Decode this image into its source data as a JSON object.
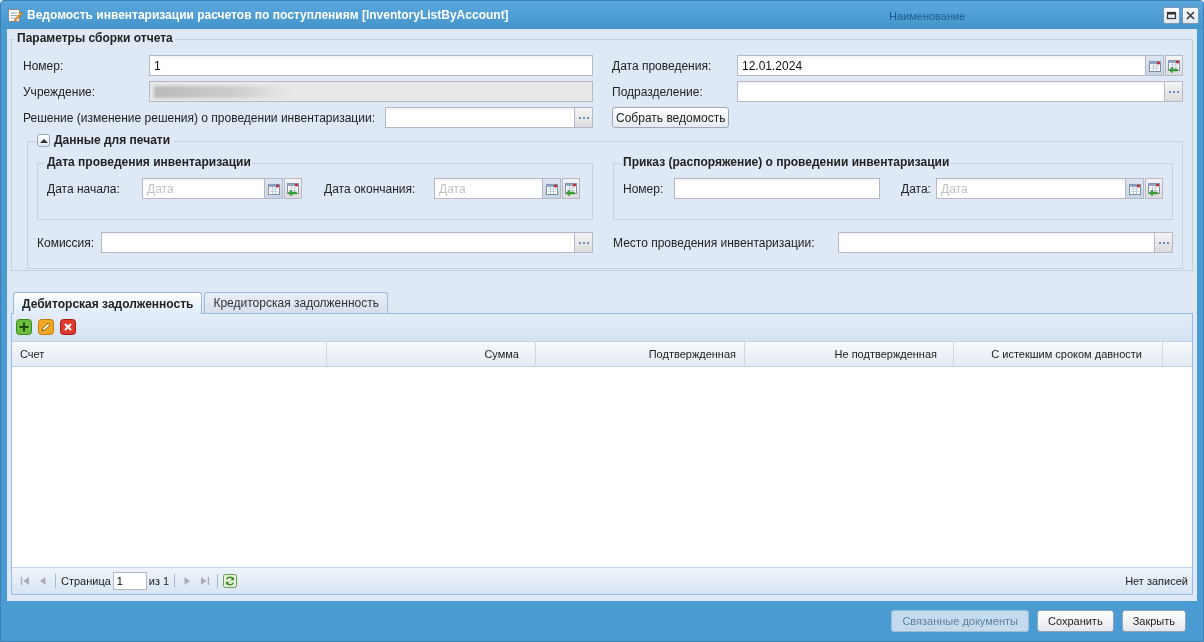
{
  "window": {
    "title": "Ведомость инвентаризации расчетов по поступлениям [InventoryListByAccount]",
    "behind_text": "Наименование"
  },
  "params": {
    "legend": "Параметры сборки отчета",
    "left_fields": [
      {
        "label": "Номер:",
        "kind": "text",
        "value": "1"
      },
      {
        "label": "Учреждение:",
        "kind": "redacted"
      },
      {
        "label": "Решение (изменение решения) о проведении инвентаризации:",
        "kind": "lookup"
      }
    ],
    "right_fields": [
      {
        "label": "Дата проведения:",
        "kind": "date",
        "value": "12.01.2024"
      },
      {
        "label": "Подразделение:",
        "kind": "lookup"
      }
    ],
    "build_button": "Собрать ведомость"
  },
  "print": {
    "legend": "Данные для печати",
    "expanded": true,
    "dates": {
      "legend": "Дата проведения инвентаризации",
      "fields": [
        {
          "label": "Дата начала:",
          "kind": "date",
          "placeholder": "Дата"
        },
        {
          "label": "Дата окончания:",
          "kind": "date",
          "placeholder": "Дата"
        }
      ]
    },
    "order": {
      "legend": "Приказ (распоряжение) о проведении инвентаризации",
      "fields": [
        {
          "label": "Номер:",
          "kind": "text"
        },
        {
          "label": "Дата:",
          "kind": "date",
          "placeholder": "Дата"
        }
      ]
    },
    "commission": {
      "label": "Комиссия:",
      "kind": "lookup"
    },
    "place": {
      "label": "Место проведения инвентаризации:",
      "kind": "lookup"
    }
  },
  "tabs": [
    {
      "label": "Дебиторская задолженность",
      "selected": true
    },
    {
      "label": "Кредиторская задолженность",
      "selected": false
    }
  ],
  "table": {
    "columns": [
      "Счет",
      "Сумма",
      "Подтвержденная",
      "Не подтвержденная",
      "С истекшим сроком давности"
    ],
    "pager": {
      "page_label": "Страница",
      "page": "1",
      "of": "из 1",
      "status": "Нет записей"
    }
  },
  "buttons": [
    {
      "label": "Связанные документы",
      "disabled": true
    },
    {
      "label": "Сохранить",
      "disabled": false
    },
    {
      "label": "Закрыть",
      "disabled": false
    }
  ]
}
